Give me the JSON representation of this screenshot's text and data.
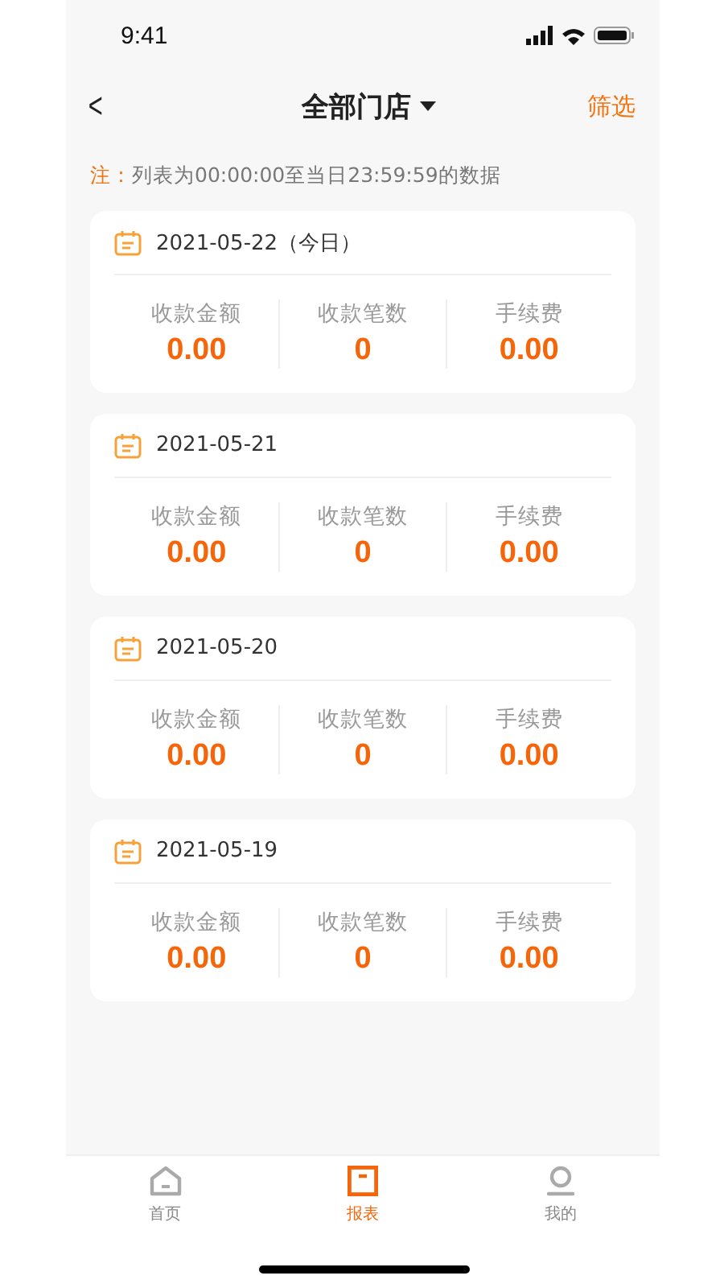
{
  "status_bar": {
    "time": "9:41"
  },
  "nav": {
    "back": "<",
    "title": "全部门店",
    "filter": "筛选"
  },
  "note": {
    "label": "注：",
    "text": "列表为00:00:00至当日23:59:59的数据"
  },
  "days": [
    {
      "date": "2021-05-22（今日）",
      "stats": [
        {
          "label": "收款金额",
          "value": "0.00"
        },
        {
          "label": "收款笔数",
          "value": "0"
        },
        {
          "label": "手续费",
          "value": "0.00"
        }
      ]
    },
    {
      "date": "2021-05-21",
      "stats": [
        {
          "label": "收款金额",
          "value": "0.00"
        },
        {
          "label": "收款笔数",
          "value": "0"
        },
        {
          "label": "手续费",
          "value": "0.00"
        }
      ]
    },
    {
      "date": "2021-05-20",
      "stats": [
        {
          "label": "收款金额",
          "value": "0.00"
        },
        {
          "label": "收款笔数",
          "value": "0"
        },
        {
          "label": "手续费",
          "value": "0.00"
        }
      ]
    },
    {
      "date": "2021-05-19",
      "stats": [
        {
          "label": "收款金额",
          "value": "0.00"
        },
        {
          "label": "收款笔数",
          "value": "0"
        },
        {
          "label": "手续费",
          "value": "0.00"
        }
      ]
    }
  ],
  "tabs": [
    {
      "kind": "home",
      "label": "首页",
      "selected": false
    },
    {
      "kind": "report",
      "label": "报表",
      "selected": true
    },
    {
      "kind": "profile",
      "label": "我的",
      "selected": false
    }
  ]
}
